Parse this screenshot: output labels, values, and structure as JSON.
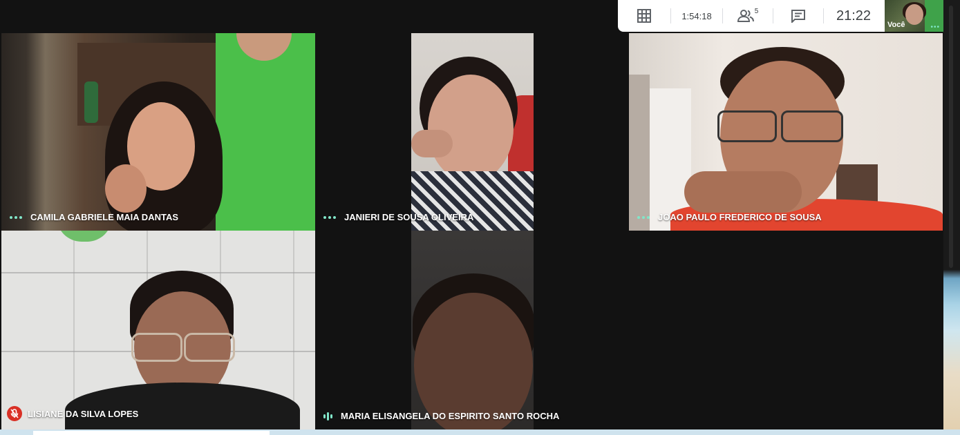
{
  "meeting": {
    "elapsed": "1:54:18",
    "participants_count": "5",
    "clock": "21:22",
    "self_label": "Você"
  },
  "participants": [
    {
      "name": "CAMILA GABRIELE MAIA DANTAS",
      "status": "more"
    },
    {
      "name": "JANIERI DE SOUSA OLIVEIRA",
      "status": "more"
    },
    {
      "name": "JOAO PAULO FREDERICO DE SOUSA",
      "status": "more"
    },
    {
      "name": "LISIANE DA SILVA LOPES",
      "status": "muted"
    },
    {
      "name": "MARIA ELISANGELA DO ESPIRITO SANTO ROCHA",
      "status": "speaking"
    }
  ],
  "colors": {
    "accent_teal": "#81e6c9",
    "muted_red": "#d93025",
    "background": "#121212",
    "panel": "#ffffff"
  },
  "icons": [
    "grid-icon",
    "people-icon",
    "chat-icon",
    "more-options-icon",
    "mic-off-icon",
    "speaking-icon"
  ]
}
